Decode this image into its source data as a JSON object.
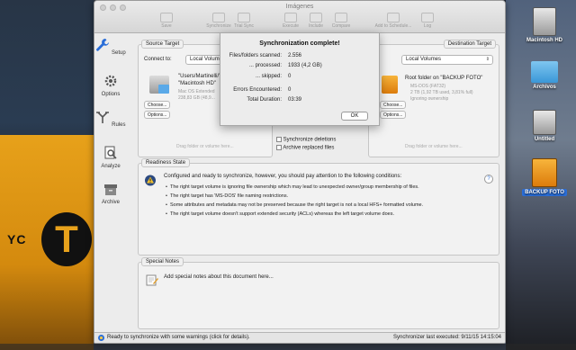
{
  "desktop": {
    "taxi_sign": "YC",
    "taxi_letter": "T",
    "icons": [
      {
        "label": "Macintosh HD"
      },
      {
        "label": "Archivos"
      },
      {
        "label": "Untitled"
      },
      {
        "label": "BACKUP FOTO"
      }
    ]
  },
  "window": {
    "title": "Imágenes",
    "toolbar": [
      "Save",
      "Synchronize",
      "Trial Sync",
      "Execute",
      "Include",
      "Compare",
      "Add to Schedule...",
      "Log"
    ]
  },
  "sidebar": {
    "items": [
      {
        "label": "Setup",
        "icon": "wrench-icon"
      },
      {
        "label": "Options",
        "icon": "gear-icon"
      },
      {
        "label": "Rules",
        "icon": "branch-icon"
      },
      {
        "label": "Analyze",
        "icon": "magnifier-icon"
      },
      {
        "label": "Archive",
        "icon": "archive-box-icon"
      }
    ]
  },
  "source": {
    "tab": "Source Target",
    "connect_label": "Connect to:",
    "connect_value": "Local Volumes",
    "path": "\"Users/Martinelli/\" on",
    "volume": "\"Macintosh HD\"",
    "detail1": "Mac OS Extended",
    "detail2": "238,83 GB (48,9...",
    "choose": "Choose...",
    "options": "Options...",
    "hint": "Drag folder or volume here..."
  },
  "destination": {
    "tab": "Destination Target",
    "connect_value": "Local Volumes",
    "path": "Root folder on \"BACKUP FOTO\"",
    "detail1": "MS-DOS (FAT32)",
    "detail2": "2 TB (1,92 TB used, 3,81% full)",
    "detail3": "Ignoring ownership",
    "choose": "Choose...",
    "options": "Options...",
    "hint": "Drag folder or volume here..."
  },
  "sync_options": {
    "deletions": "Synchronize deletions",
    "archive": "Archive replaced files"
  },
  "dialog": {
    "title": "Synchronization complete!",
    "rows": [
      {
        "label": "Files/folders scanned:",
        "value": "2.556"
      },
      {
        "label": "... processed:",
        "value": "1933 (4,2 GB)"
      },
      {
        "label": "... skipped:",
        "value": "0"
      },
      {
        "label": "Errors Encountered:",
        "value": "0"
      },
      {
        "label": "Total Duration:",
        "value": "03:39"
      }
    ],
    "ok": "OK"
  },
  "readiness": {
    "tab": "Readiness State",
    "headline": "Configured and ready to synchronize, however, you should pay attention to the following conditions:",
    "items": [
      "The right target volume is ignoring file ownership which may lead to unexpected owner/group membership of files.",
      "The right target has 'MS-DOS' file naming restrictions.",
      "Some attributes and metadata may not be preserved because the right target is not a local HFS+ formatted volume.",
      "The right target volume doesn't support extended security (ACLs) whereas the left target volume does."
    ],
    "help": "?"
  },
  "notes": {
    "tab": "Special Notes",
    "placeholder": "Add special notes about this document here..."
  },
  "status": {
    "left": "Ready to synchronize with some warnings (click for details).",
    "right": "Synchronizer last executed:  9/11/15 14:15:04"
  }
}
